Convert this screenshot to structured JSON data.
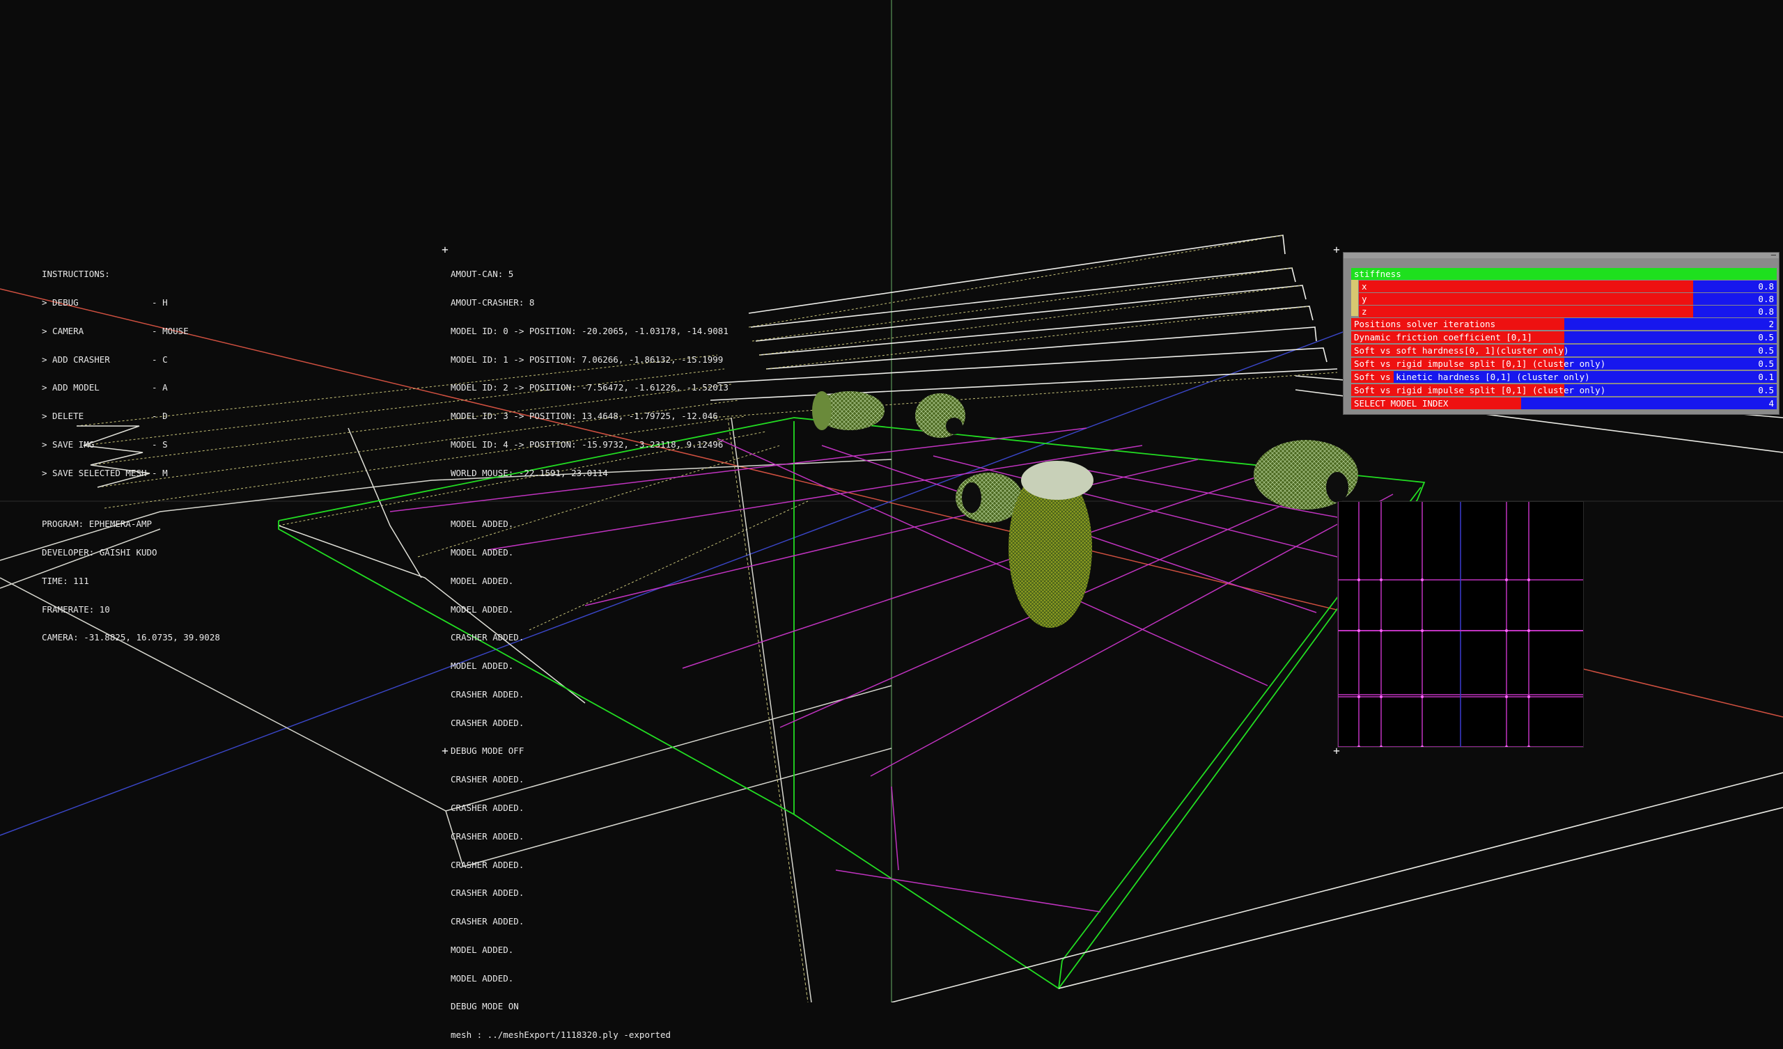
{
  "instructions": [
    "INSTRUCTIONS:",
    "> DEBUG              - H",
    "> CAMERA             - MOUSE",
    "> ADD CRASHER        - C",
    "> ADD MODEL          - A",
    "> DELETE             - D",
    "> SAVE IMG           - S",
    "> SAVE SELECTED MESH - M"
  ],
  "model_info": [
    "AMOUT-CAN: 5",
    "AMOUT-CRASHER: 8",
    "MODEL ID: 0 -> POSITION: -20.2065, -1.03178, -14.9081",
    "MODEL ID: 1 -> POSITION: 7.06266, -1.86132, -15.1999",
    "MODEL ID: 2 -> POSITION: -7.56472, -1.61226, -1.52013",
    "MODEL ID: 3 -> POSITION: 13.4648, -1.79725, -12.046",
    "MODEL ID: 4 -> POSITION: -15.9732, -3.23118, 9.12496",
    "WORLD MOUSE: -22.1591, 23.0114"
  ],
  "program_info": [
    "PROGRAM: EPHEMERA-AMP",
    "DEVELOPER: GAISHI KUDO",
    "TIME: 111",
    "FRAMERATE: 10",
    "CAMERA: -31.8825, 16.0735, 39.9028"
  ],
  "log": [
    "MODEL ADDED.",
    "MODEL ADDED.",
    "MODEL ADDED.",
    "MODEL ADDED.",
    "CRASHER ADDED.",
    "MODEL ADDED.",
    "CRASHER ADDED.",
    "CRASHER ADDED.",
    "DEBUG MODE OFF",
    "CRASHER ADDED.",
    "CRASHER ADDED.",
    "CRASHER ADDED.",
    "CRASHER ADDED.",
    "CRASHER ADDED.",
    "CRASHER ADDED.",
    "MODEL ADDED.",
    "MODEL ADDED.",
    "DEBUG MODE ON",
    "mesh : ../meshExport/1118320.ply -exported"
  ],
  "panel": {
    "group_label": "stiffness",
    "vector": [
      {
        "label": "x",
        "value": "0.8",
        "fraction": 0.8
      },
      {
        "label": "y",
        "value": "0.8",
        "fraction": 0.8
      },
      {
        "label": "z",
        "value": "0.8",
        "fraction": 0.8
      }
    ],
    "params": [
      {
        "label": "Positions solver iterations",
        "value": "2",
        "fraction": 0.5
      },
      {
        "label": " Dynamic friction coefficient [0,1]",
        "value": "0.5",
        "fraction": 0.5
      },
      {
        "label": "Soft vs soft hardness[0, 1](cluster only)",
        "value": "0.5",
        "fraction": 0.5
      },
      {
        "label": "Soft vs rigid impulse split [0,1] (cluster only)",
        "value": "0.5",
        "fraction": 0.5
      },
      {
        "label": "Soft vs kinetic hardness [0,1] (cluster only)",
        "value": "0.1",
        "fraction": 0.1
      },
      {
        "label": "Soft vs rigid impulse split [0,1] (cluster only)",
        "value": "0.5",
        "fraction": 0.5
      },
      {
        "label": "SELECT MODEL INDEX",
        "value": "4",
        "fraction": 0.4
      }
    ]
  },
  "colors": {
    "background": "#0b0b0b",
    "slider_fill": "#ee1111",
    "slider_track": "#1717ee",
    "group_header": "#1ee01e",
    "floor_outline": "#22dd22",
    "grid_lines": "#cc33cc",
    "ramp_wire": "#d9d9c8",
    "can_mesh": "#7a9a30"
  }
}
